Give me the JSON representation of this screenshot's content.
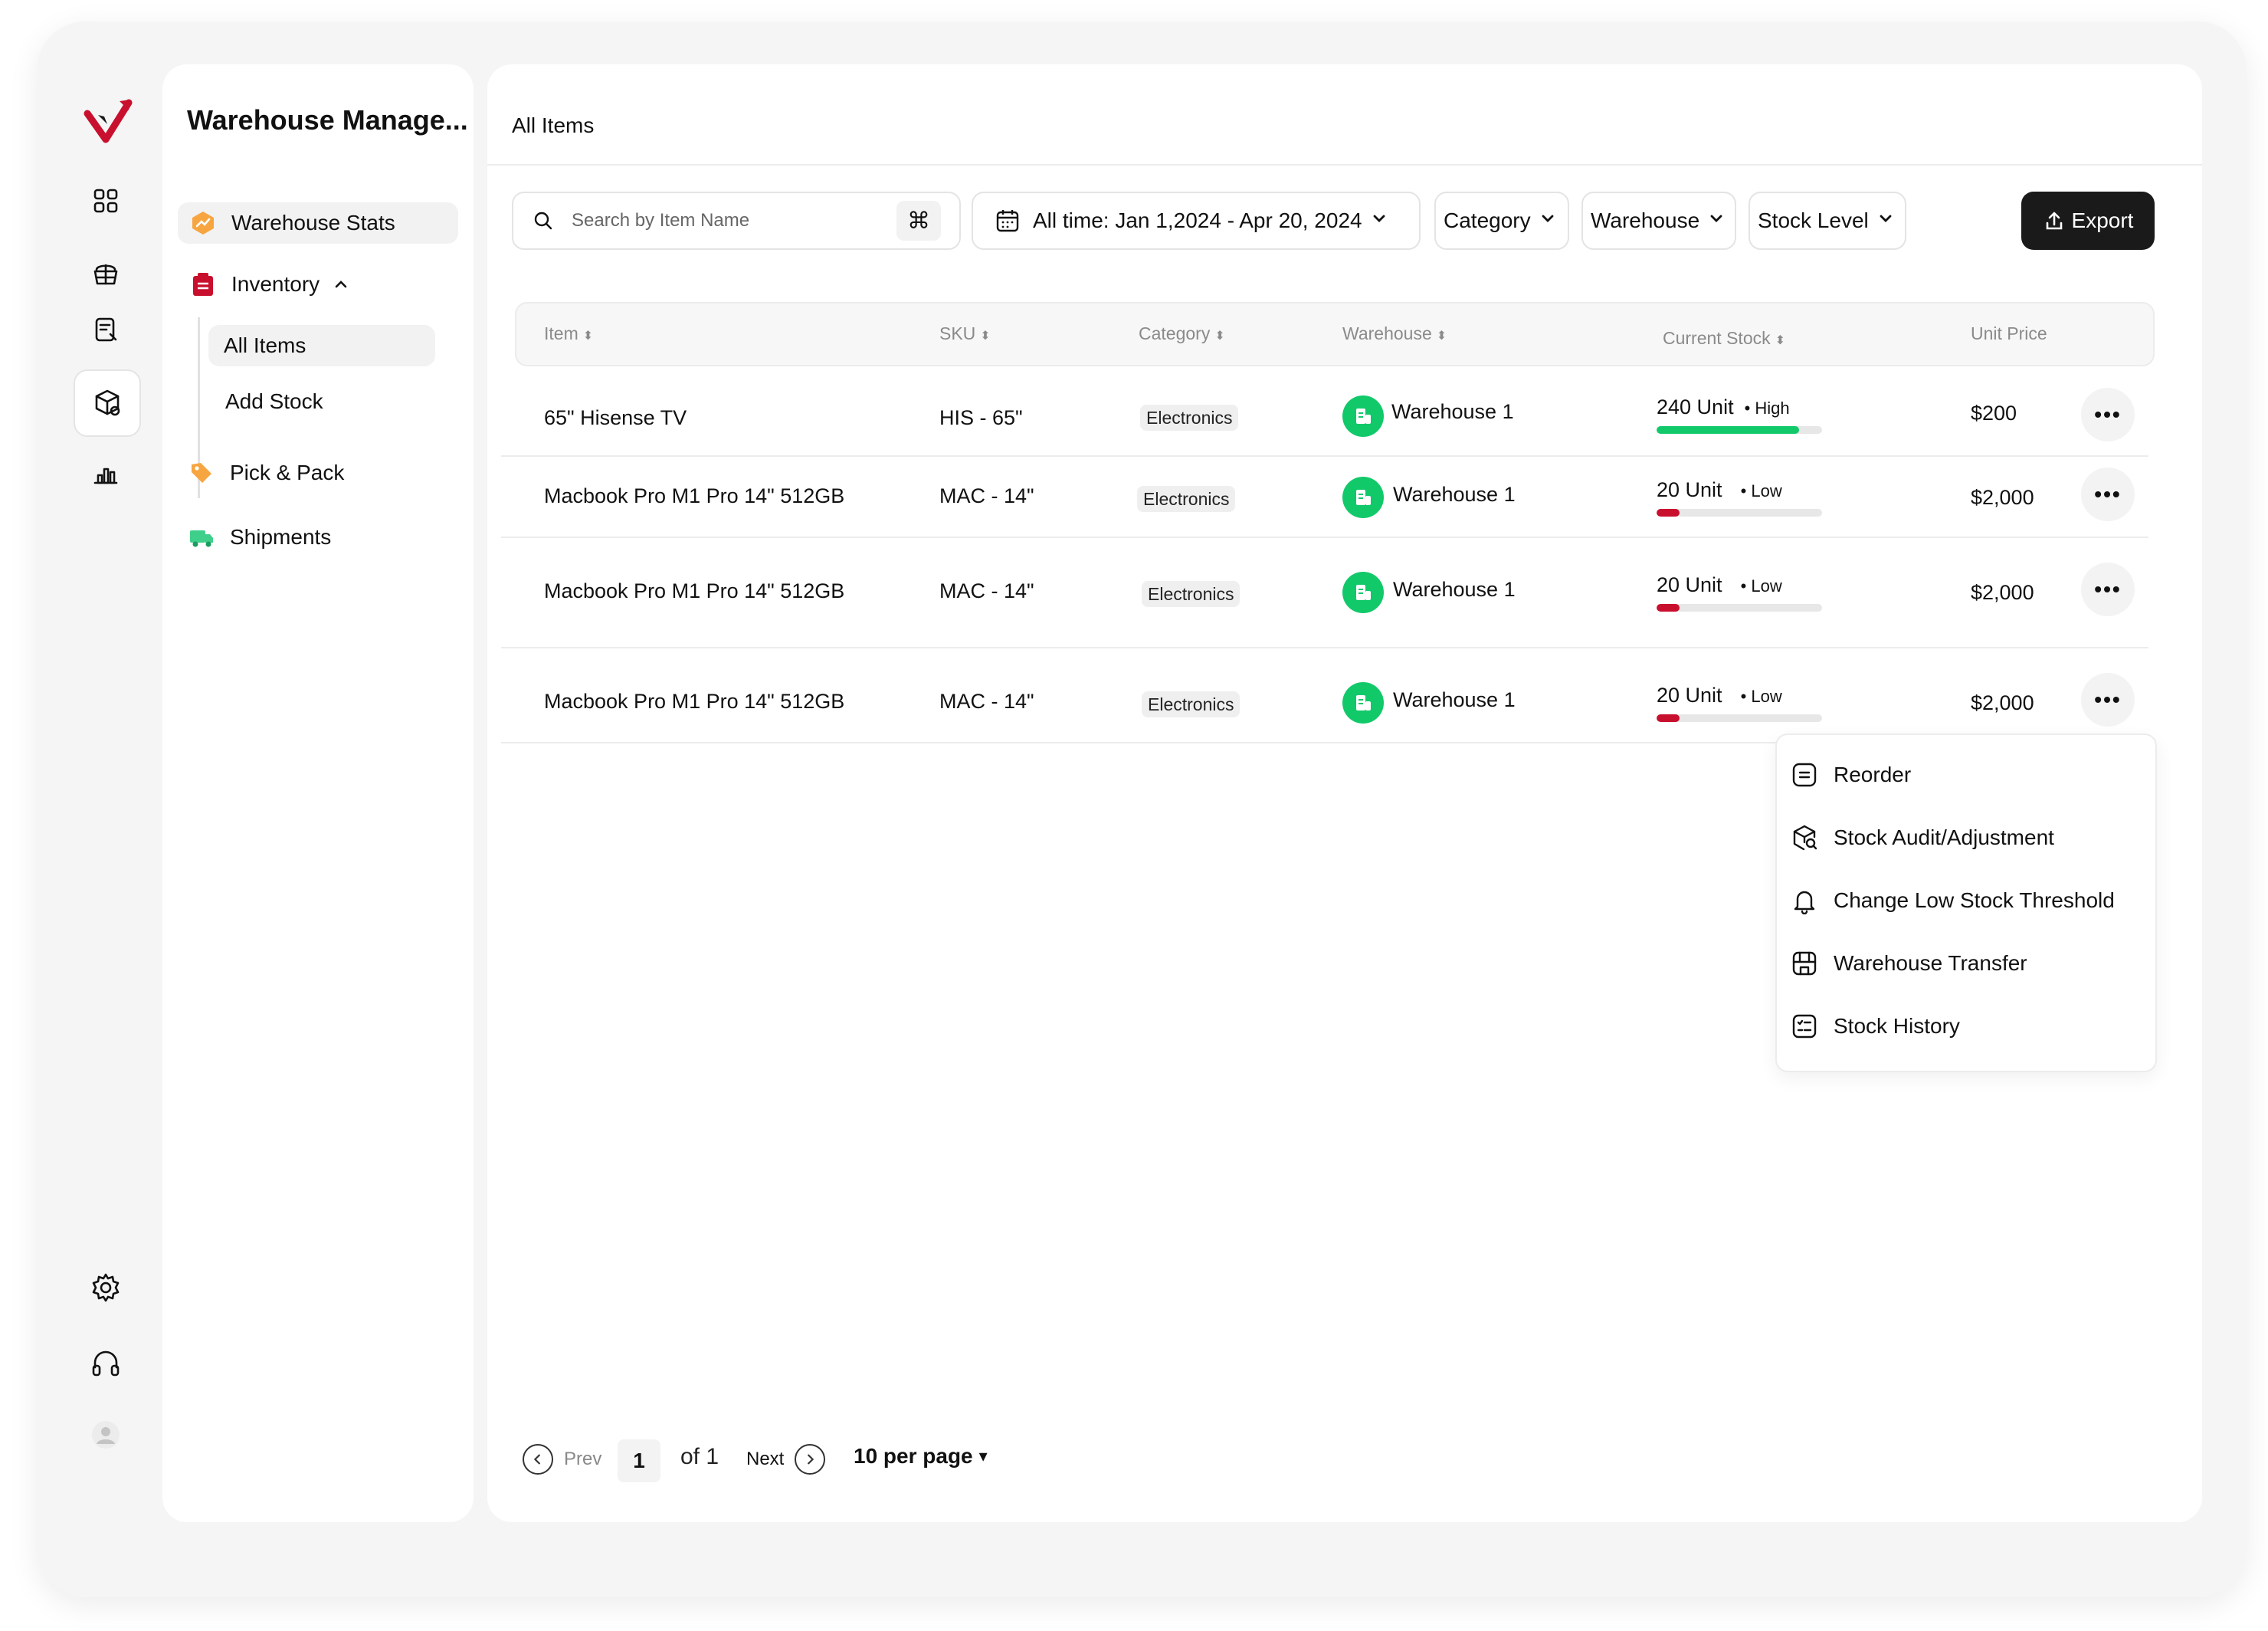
{
  "app": {
    "title": "Warehouse Manage..."
  },
  "rail": {
    "icons": [
      "logo-icon",
      "grid-icon",
      "box-stack-icon",
      "document-icon",
      "package-icon",
      "chart-icon",
      "settings-icon",
      "headset-icon",
      "user-avatar-icon"
    ]
  },
  "sidebar": {
    "items": [
      {
        "label": "Warehouse Stats",
        "icon": "chart-badge-icon"
      },
      {
        "label": "Inventory",
        "icon": "inventory-icon"
      },
      {
        "label": "All Items"
      },
      {
        "label": "Add Stock"
      },
      {
        "label": "Pick & Pack",
        "icon": "tag-icon"
      },
      {
        "label": "Shipments",
        "icon": "truck-icon"
      }
    ]
  },
  "main": {
    "title": "All Items"
  },
  "filters": {
    "search_placeholder": "Search by Item Name",
    "kbd": "⌘",
    "date": "All time: Jan 1,2024 - Apr 20, 2024",
    "category": "Category",
    "warehouse": "Warehouse",
    "stock_level": "Stock Level",
    "export": "Export"
  },
  "table": {
    "headers": [
      "Item",
      "SKU",
      "Category",
      "Warehouse",
      "Current Stock",
      "Unit Price"
    ],
    "rows": [
      {
        "item": "65\" Hisense TV",
        "sku": "HIS - 65\"",
        "category": "Electronics",
        "warehouse": "Warehouse 1",
        "stock": "240 Unit",
        "level": "• High",
        "level_fraction": 0.86,
        "price": "$200"
      },
      {
        "item": "Macbook Pro M1 Pro 14\" 512GB",
        "sku": "MAC - 14\"",
        "category": "Electronics",
        "warehouse": "Warehouse 1",
        "stock": "20 Unit",
        "level": "• Low",
        "level_fraction": 0.14,
        "price": "$2,000"
      },
      {
        "item": "Macbook Pro M1 Pro 14\" 512GB",
        "sku": "MAC - 14\"",
        "category": "Electronics",
        "warehouse": "Warehouse 1",
        "stock": "20 Unit",
        "level": "• Low",
        "level_fraction": 0.14,
        "price": "$2,000"
      },
      {
        "item": "Macbook Pro M1 Pro 14\" 512GB",
        "sku": "MAC - 14\"",
        "category": "Electronics",
        "warehouse": "Warehouse 1",
        "stock": "20 Unit",
        "level": "• Low",
        "level_fraction": 0.14,
        "price": "$2,000"
      }
    ]
  },
  "row_menu": {
    "items": [
      {
        "label": "Reorder",
        "icon": "reorder-icon"
      },
      {
        "label": "Stock Audit/Adjustment",
        "icon": "audit-icon"
      },
      {
        "label": "Change Low Stock Threshold",
        "icon": "bell-icon"
      },
      {
        "label": "Warehouse Transfer",
        "icon": "transfer-icon"
      },
      {
        "label": "Stock History",
        "icon": "history-icon"
      }
    ]
  },
  "pagination": {
    "prev": "Prev",
    "page": "1",
    "of": "of 1",
    "next": "Next",
    "per_page": "10 per page"
  },
  "colors": {
    "accent": "#1a1a1a",
    "high": "#12c96a",
    "low": "#c8102e",
    "warehouse_icon": "#12c96a",
    "logo": "#c8102e"
  }
}
